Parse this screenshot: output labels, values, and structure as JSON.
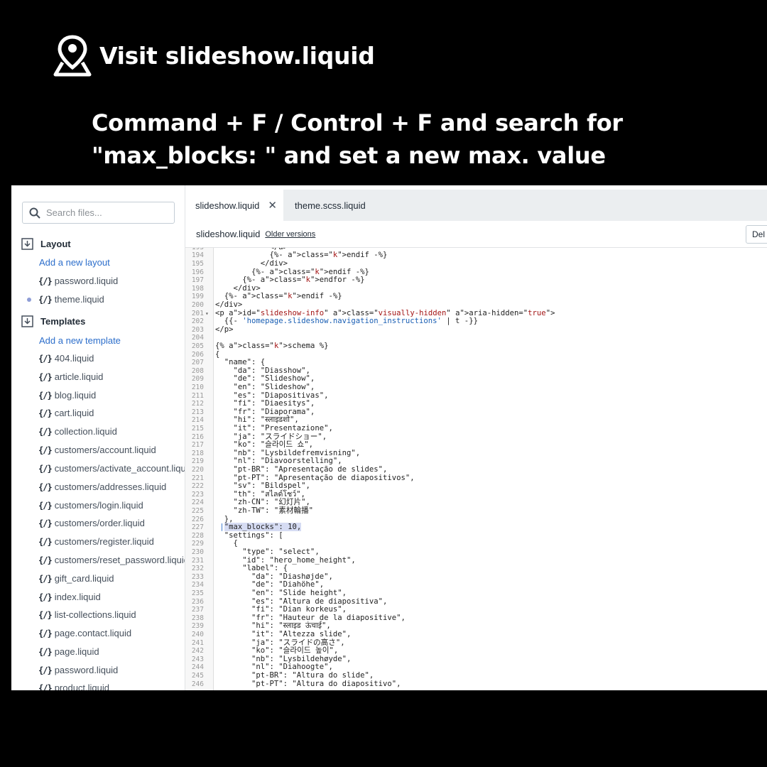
{
  "header": {
    "title": "Visit slideshow.liquid",
    "instruction_lines": [
      "Command + F / Control + F and search for",
      "\"max_blocks: \" and set a new max. value"
    ]
  },
  "sidebar": {
    "search_placeholder": "Search files...",
    "layout": {
      "heading": "Layout",
      "add_link": "Add a new layout",
      "files": [
        "password.liquid",
        "theme.liquid"
      ]
    },
    "templates": {
      "heading": "Templates",
      "add_link": "Add a new template",
      "files": [
        "404.liquid",
        "article.liquid",
        "blog.liquid",
        "cart.liquid",
        "collection.liquid",
        "customers/account.liquid",
        "customers/activate_account.liquid",
        "customers/addresses.liquid",
        "customers/login.liquid",
        "customers/order.liquid",
        "customers/register.liquid",
        "customers/reset_password.liquid",
        "gift_card.liquid",
        "index.liquid",
        "list-collections.liquid",
        "page.contact.liquid",
        "page.liquid",
        "password.liquid",
        "product.liquid"
      ]
    },
    "file_icon": "{/}"
  },
  "editor": {
    "tabs": [
      {
        "label": "slideshow.liquid",
        "active": true
      },
      {
        "label": "theme.scss.liquid",
        "active": false
      }
    ],
    "filename": "slideshow.liquid",
    "older_versions": "Older versions",
    "delete_label": "Del",
    "highlighted_line": 227,
    "code_lines": [
      {
        "n": "193",
        "t": "            </a>"
      },
      {
        "n": "194",
        "t": "            {%- endif -%}"
      },
      {
        "n": "195",
        "t": "          </div>"
      },
      {
        "n": "196",
        "t": "        {%- endif -%}"
      },
      {
        "n": "197",
        "t": "      {%- endfor -%}"
      },
      {
        "n": "198",
        "t": "    </div>"
      },
      {
        "n": "199",
        "t": "  {%- endif -%}"
      },
      {
        "n": "200",
        "t": "</div>"
      },
      {
        "n": "201",
        "t": "<p id=\"slideshow-info\" class=\"visually-hidden\" aria-hidden=\"true\">",
        "fold": true
      },
      {
        "n": "202",
        "t": "  {{- 'homepage.slideshow.navigation_instructions' | t -}}"
      },
      {
        "n": "203",
        "t": "</p>"
      },
      {
        "n": "204",
        "t": ""
      },
      {
        "n": "205",
        "t": "{% schema %}"
      },
      {
        "n": "206",
        "t": "{"
      },
      {
        "n": "207",
        "t": "  \"name\": {"
      },
      {
        "n": "208",
        "t": "    \"da\": \"Diasshow\","
      },
      {
        "n": "209",
        "t": "    \"de\": \"Slideshow\","
      },
      {
        "n": "210",
        "t": "    \"en\": \"Slideshow\","
      },
      {
        "n": "211",
        "t": "    \"es\": \"Diapositivas\","
      },
      {
        "n": "212",
        "t": "    \"fi\": \"Diaesitys\","
      },
      {
        "n": "213",
        "t": "    \"fr\": \"Diaporama\","
      },
      {
        "n": "214",
        "t": "    \"hi\": \"स्लाइडशो\","
      },
      {
        "n": "215",
        "t": "    \"it\": \"Presentazione\","
      },
      {
        "n": "216",
        "t": "    \"ja\": \"スライドショー\","
      },
      {
        "n": "217",
        "t": "    \"ko\": \"슬라이드 쇼\","
      },
      {
        "n": "218",
        "t": "    \"nb\": \"Lysbildefremvisning\","
      },
      {
        "n": "219",
        "t": "    \"nl\": \"Diavoorstelling\","
      },
      {
        "n": "220",
        "t": "    \"pt-BR\": \"Apresentação de slides\","
      },
      {
        "n": "221",
        "t": "    \"pt-PT\": \"Apresentação de diapositivos\","
      },
      {
        "n": "222",
        "t": "    \"sv\": \"Bildspel\","
      },
      {
        "n": "223",
        "t": "    \"th\": \"สไลด์โชว์\","
      },
      {
        "n": "224",
        "t": "    \"zh-CN\": \"幻灯片\","
      },
      {
        "n": "225",
        "t": "    \"zh-TW\": \"素材輪播\""
      },
      {
        "n": "226",
        "t": "  },"
      },
      {
        "n": "227",
        "t": "  \"max_blocks\": 10,"
      },
      {
        "n": "228",
        "t": "  \"settings\": ["
      },
      {
        "n": "229",
        "t": "    {"
      },
      {
        "n": "230",
        "t": "      \"type\": \"select\","
      },
      {
        "n": "231",
        "t": "      \"id\": \"hero_home_height\","
      },
      {
        "n": "232",
        "t": "      \"label\": {"
      },
      {
        "n": "233",
        "t": "        \"da\": \"Diashøjde\","
      },
      {
        "n": "234",
        "t": "        \"de\": \"Diahöhe\","
      },
      {
        "n": "235",
        "t": "        \"en\": \"Slide height\","
      },
      {
        "n": "236",
        "t": "        \"es\": \"Altura de diapositiva\","
      },
      {
        "n": "237",
        "t": "        \"fi\": \"Dian korkeus\","
      },
      {
        "n": "238",
        "t": "        \"fr\": \"Hauteur de la diapositive\","
      },
      {
        "n": "239",
        "t": "        \"hi\": \"स्लाइड ऊंचाई\","
      },
      {
        "n": "240",
        "t": "        \"it\": \"Altezza slide\","
      },
      {
        "n": "241",
        "t": "        \"ja\": \"スライドの高さ\","
      },
      {
        "n": "242",
        "t": "        \"ko\": \"슬라이드 높이\","
      },
      {
        "n": "243",
        "t": "        \"nb\": \"Lysbildehøyde\","
      },
      {
        "n": "244",
        "t": "        \"nl\": \"Diahoogte\","
      },
      {
        "n": "245",
        "t": "        \"pt-BR\": \"Altura do slide\","
      },
      {
        "n": "246",
        "t": "        \"pt-PT\": \"Altura do diapositivo\","
      }
    ]
  }
}
